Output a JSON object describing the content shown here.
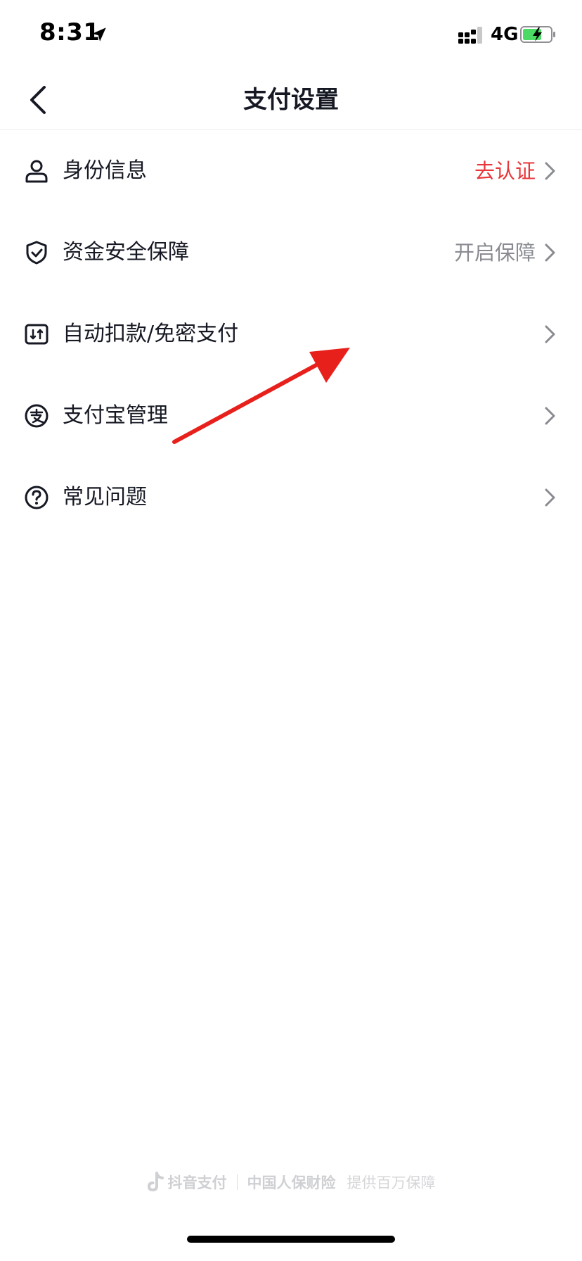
{
  "status_bar": {
    "time": "8:31",
    "network": "4G",
    "icons": [
      "location-arrow-icon",
      "signal-icon",
      "battery-charging-icon"
    ]
  },
  "nav": {
    "back_icon": "chevron-left-icon",
    "title": "支付设置"
  },
  "menu": [
    {
      "icon": "user-icon",
      "label": "身份信息",
      "value": "去认证",
      "value_color": "#e8363b"
    },
    {
      "icon": "shield-check-icon",
      "label": "资金安全保障",
      "value": "开启保障",
      "value_color": "#8a8b91"
    },
    {
      "icon": "auto-deduct-icon",
      "label": "自动扣款/免密支付",
      "value": ""
    },
    {
      "icon": "alipay-icon",
      "label": "支付宝管理",
      "value": ""
    },
    {
      "icon": "question-circle-icon",
      "label": "常见问题",
      "value": ""
    }
  ],
  "footer": {
    "brand1": "抖音支付",
    "brand2": "中国人保财险",
    "slogan": "提供百万保障"
  },
  "colors": {
    "accent_red": "#e8363b",
    "annotation_arrow": "#e8201c",
    "text_primary": "#161823",
    "text_secondary": "#8a8b91"
  }
}
